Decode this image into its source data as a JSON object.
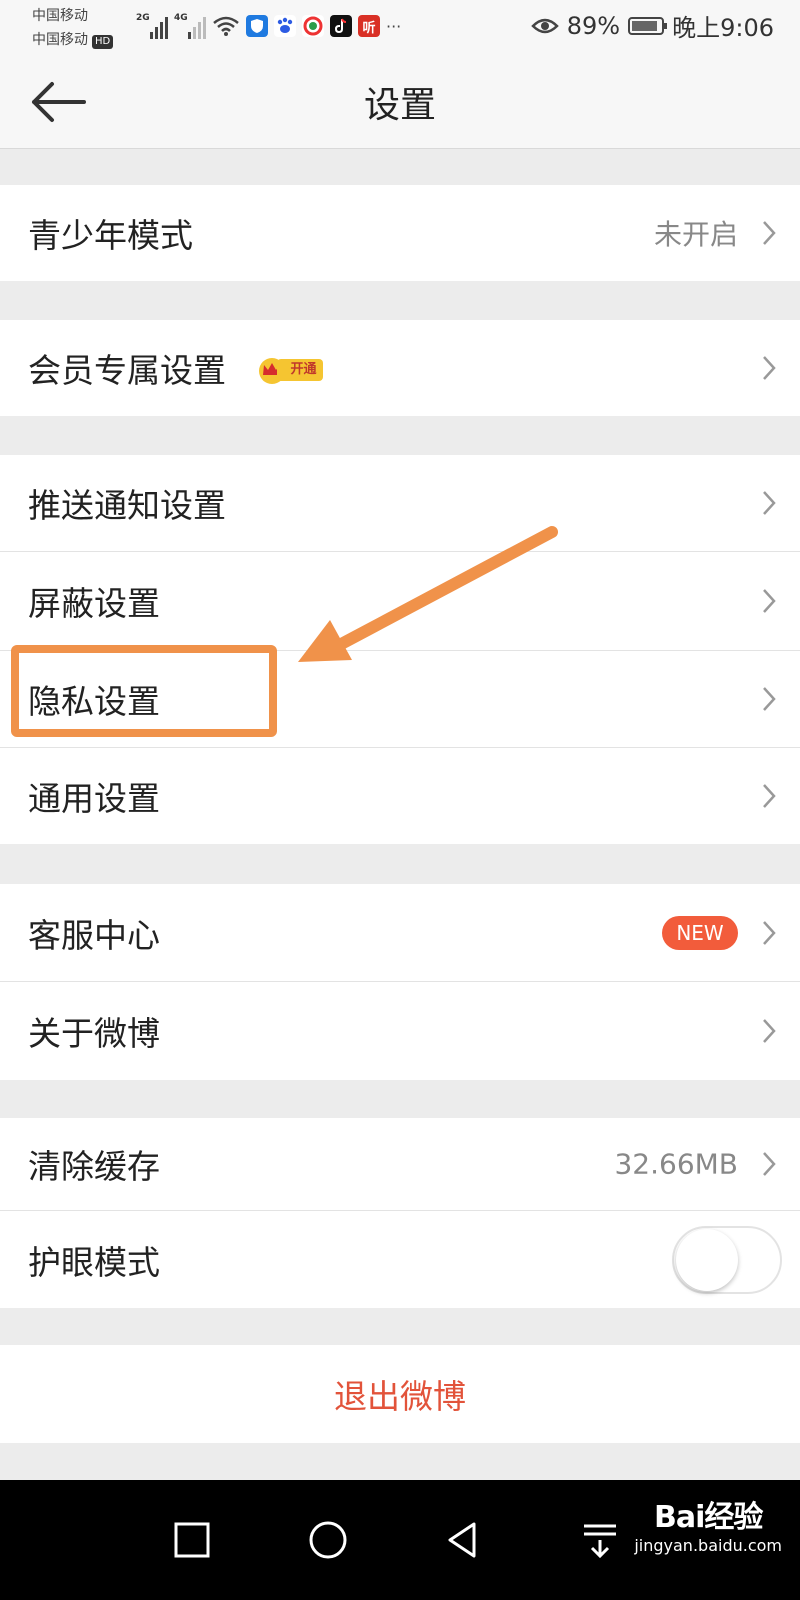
{
  "status_bar": {
    "carrier1": "中国移动",
    "carrier2": "中国移动",
    "hd": "HD",
    "sig1_label": "2G",
    "sig2_label": "4G",
    "app_icon_ting": "听",
    "more": "···",
    "battery_pct": "89%",
    "battery_level": 0.89,
    "time": "晚上9:06"
  },
  "header": {
    "title": "设置"
  },
  "sections": [
    {
      "rows": [
        {
          "label": "青少年模式",
          "value": "未开启"
        }
      ]
    },
    {
      "rows": [
        {
          "label": "会员专属设置",
          "badge": "开通"
        }
      ]
    },
    {
      "rows": [
        {
          "label": "推送通知设置"
        },
        {
          "label": "屏蔽设置"
        },
        {
          "label": "隐私设置"
        },
        {
          "label": "通用设置"
        }
      ]
    },
    {
      "rows": [
        {
          "label": "客服中心",
          "badge": "NEW"
        },
        {
          "label": "关于微博"
        }
      ]
    },
    {
      "rows": [
        {
          "label": "清除缓存",
          "value": "32.66MB"
        },
        {
          "label": "护眼模式",
          "toggle_on": false
        }
      ]
    }
  ],
  "logout": {
    "label": "退出微博"
  },
  "watermark": {
    "line1": "Bai经验",
    "line2": "jingyan.baidu.com"
  },
  "colors": {
    "accent_orange": "#f0924a",
    "logout_red": "#e2533a",
    "new_badge": "#f25c3b",
    "background": "#ececec"
  }
}
